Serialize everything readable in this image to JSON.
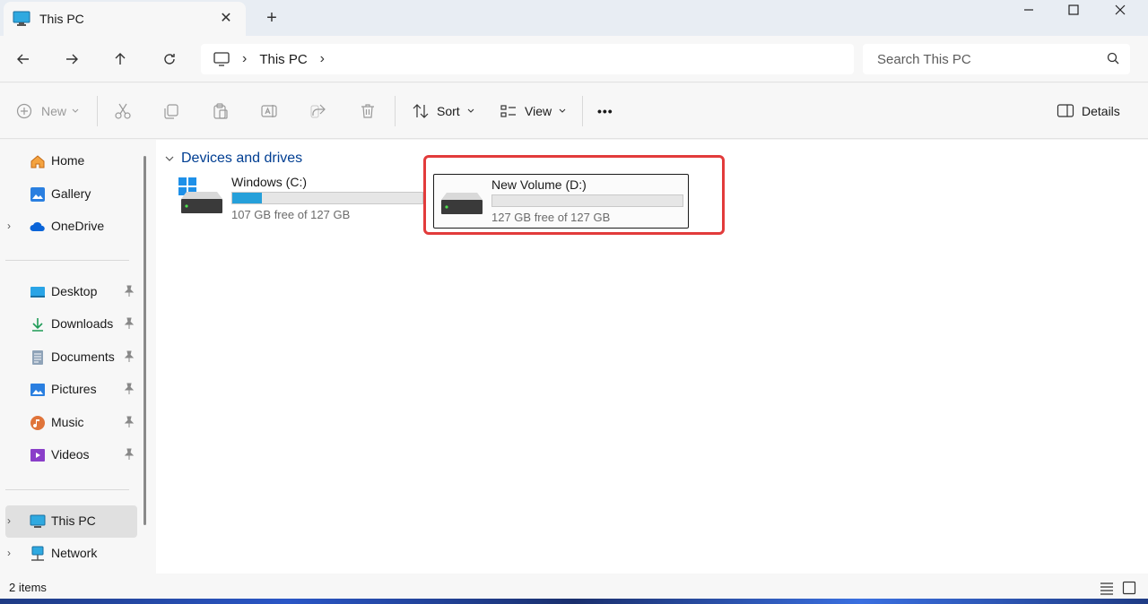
{
  "window": {
    "tab_title": "This PC",
    "tab_close": "✕",
    "new_tab": "+",
    "minimize": "—",
    "maximize": "☐",
    "close": "✕"
  },
  "address": {
    "breadcrumbs": [
      "This PC"
    ],
    "search_placeholder": "Search This PC"
  },
  "toolbar": {
    "new_label": "New",
    "sort_label": "Sort",
    "view_label": "View",
    "more_label": "•••",
    "details_label": "Details"
  },
  "sidebar": {
    "items": [
      {
        "label": "Home",
        "icon": "home-icon"
      },
      {
        "label": "Gallery",
        "icon": "gallery-icon"
      },
      {
        "label": "OneDrive",
        "icon": "cloud-icon"
      },
      {
        "label": "Desktop",
        "icon": "desktop-folder-icon"
      },
      {
        "label": "Downloads",
        "icon": "download-icon"
      },
      {
        "label": "Documents",
        "icon": "document-icon"
      },
      {
        "label": "Pictures",
        "icon": "picture-icon"
      },
      {
        "label": "Music",
        "icon": "music-icon"
      },
      {
        "label": "Videos",
        "icon": "video-icon"
      },
      {
        "label": "This PC",
        "icon": "monitor-icon"
      },
      {
        "label": "Network",
        "icon": "network-icon"
      }
    ]
  },
  "main": {
    "section_title": "Devices and drives",
    "drives": [
      {
        "name": "Windows (C:)",
        "free_text": "107 GB free of 127 GB",
        "used_fraction": 0.157,
        "bar_color": "#26a0da"
      },
      {
        "name": "New Volume (D:)",
        "free_text": "127 GB free of 127 GB",
        "used_fraction": 0.0,
        "bar_color": "#26a0da"
      }
    ]
  },
  "status": {
    "item_count": "2 items"
  },
  "colors": {
    "accent": "#26a0da",
    "highlight": "#e23b3b",
    "section_title": "#003e92"
  }
}
